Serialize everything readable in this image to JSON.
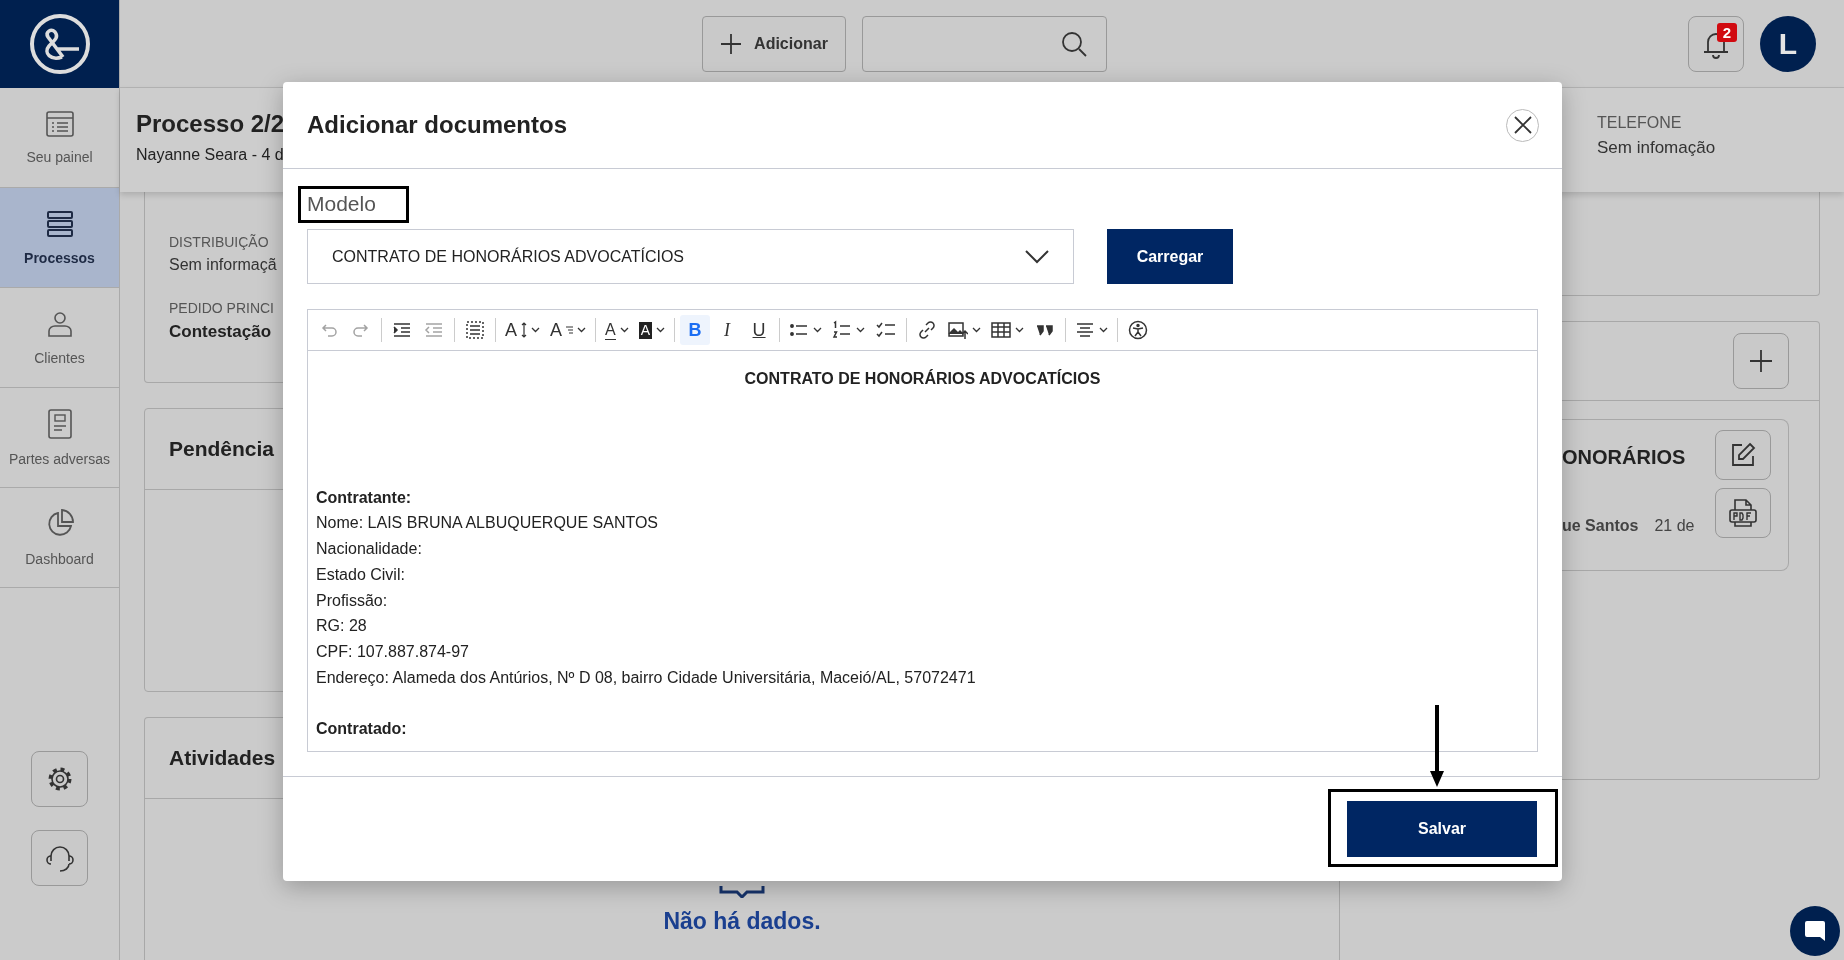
{
  "sidebar": {
    "items": [
      {
        "label": "Seu painel",
        "selected": false
      },
      {
        "label": "Processos",
        "selected": true
      },
      {
        "label": "Clientes",
        "selected": false
      },
      {
        "label": "Partes adversas",
        "selected": false
      },
      {
        "label": "Dashboard",
        "selected": false
      }
    ]
  },
  "topbar": {
    "add_button": "Adicionar",
    "notification_count": "2",
    "avatar_initial": "L"
  },
  "process_header": {
    "title": "Processo 2/2",
    "subtitle": "Nayanne Seara - 4 d",
    "phone_label": "TELEFONE",
    "phone_value": "Sem infomação"
  },
  "details_card": {
    "fields": [
      {
        "label": "DISTRIBUIÇÃO",
        "value": "Sem informaçã"
      },
      {
        "label": "PEDIDO PRINCI",
        "value": "Contestação"
      }
    ]
  },
  "pending_card": {
    "title": "Pendência"
  },
  "activities_card": {
    "title": "Atividades",
    "empty_text": "Não há dados."
  },
  "documents_card": {
    "title": "ONORÁRIOS",
    "author": "ue Santos",
    "date": "21 de"
  },
  "modal": {
    "title": "Adicionar documentos",
    "model_label": "Modelo",
    "model_value": "CONTRATO DE HONORÁRIOS ADVOCATÍCIOS",
    "load_button": "Carregar",
    "toolbar": [
      [
        {
          "kind": "undo",
          "disabled": true,
          "active": false,
          "dropdown": false
        },
        {
          "kind": "redo",
          "disabled": true,
          "active": false,
          "dropdown": false
        }
      ],
      [
        {
          "kind": "indent",
          "disabled": false,
          "active": false,
          "dropdown": false
        },
        {
          "kind": "outdent",
          "disabled": true,
          "active": false,
          "dropdown": false
        }
      ],
      [
        {
          "kind": "select-all",
          "disabled": false,
          "active": false,
          "dropdown": false
        }
      ],
      [
        {
          "kind": "font-size",
          "glyph": "A",
          "disabled": false,
          "active": false,
          "dropdown": true
        },
        {
          "kind": "font-family",
          "glyph": "A",
          "disabled": false,
          "active": false,
          "dropdown": true
        }
      ],
      [
        {
          "kind": "font-color",
          "glyph": "A",
          "disabled": false,
          "active": false,
          "dropdown": true
        },
        {
          "kind": "highlight",
          "glyph": "A",
          "disabled": false,
          "active": false,
          "dropdown": true
        }
      ],
      [
        {
          "kind": "bold",
          "glyph": "B",
          "disabled": false,
          "active": true,
          "dropdown": false
        },
        {
          "kind": "italic",
          "glyph": "I",
          "disabled": false,
          "active": false,
          "dropdown": false
        },
        {
          "kind": "underline",
          "glyph": "U",
          "disabled": false,
          "active": false,
          "dropdown": false
        }
      ],
      [
        {
          "kind": "bulleted-list",
          "disabled": false,
          "active": false,
          "dropdown": true
        },
        {
          "kind": "numbered-list",
          "disabled": false,
          "active": false,
          "dropdown": true
        },
        {
          "kind": "todo-list",
          "disabled": false,
          "active": false,
          "dropdown": false
        }
      ],
      [
        {
          "kind": "link",
          "disabled": false,
          "active": false,
          "dropdown": false
        },
        {
          "kind": "image",
          "disabled": false,
          "active": false,
          "dropdown": true
        },
        {
          "kind": "table",
          "disabled": false,
          "active": false,
          "dropdown": true
        },
        {
          "kind": "quote",
          "disabled": false,
          "active": false,
          "dropdown": false
        }
      ],
      [
        {
          "kind": "align",
          "disabled": false,
          "active": false,
          "dropdown": true
        }
      ],
      [
        {
          "kind": "accessibility",
          "disabled": false,
          "active": false,
          "dropdown": false
        }
      ]
    ],
    "document": [
      {
        "kind": "heading",
        "text": "CONTRATO DE HONORÁRIOS ADVOCATÍCIOS"
      },
      {
        "kind": "label",
        "text": "Contratante:"
      },
      {
        "kind": "line",
        "text": "Nome: LAIS BRUNA ALBUQUERQUE SANTOS"
      },
      {
        "kind": "line",
        "text": "Nacionalidade:"
      },
      {
        "kind": "line",
        "text": "Estado Civil:"
      },
      {
        "kind": "line",
        "text": "Profissão:"
      },
      {
        "kind": "line",
        "text": "RG: 28"
      },
      {
        "kind": "line",
        "text": "CPF: 107.887.874-97"
      },
      {
        "kind": "line",
        "text": "Endereço: Alameda dos Antúrios, Nº D 08, bairro Cidade Universitária, Maceió/AL, 57072471"
      },
      {
        "kind": "label",
        "text": "Contratado:"
      }
    ],
    "save_button": "Salvar"
  }
}
